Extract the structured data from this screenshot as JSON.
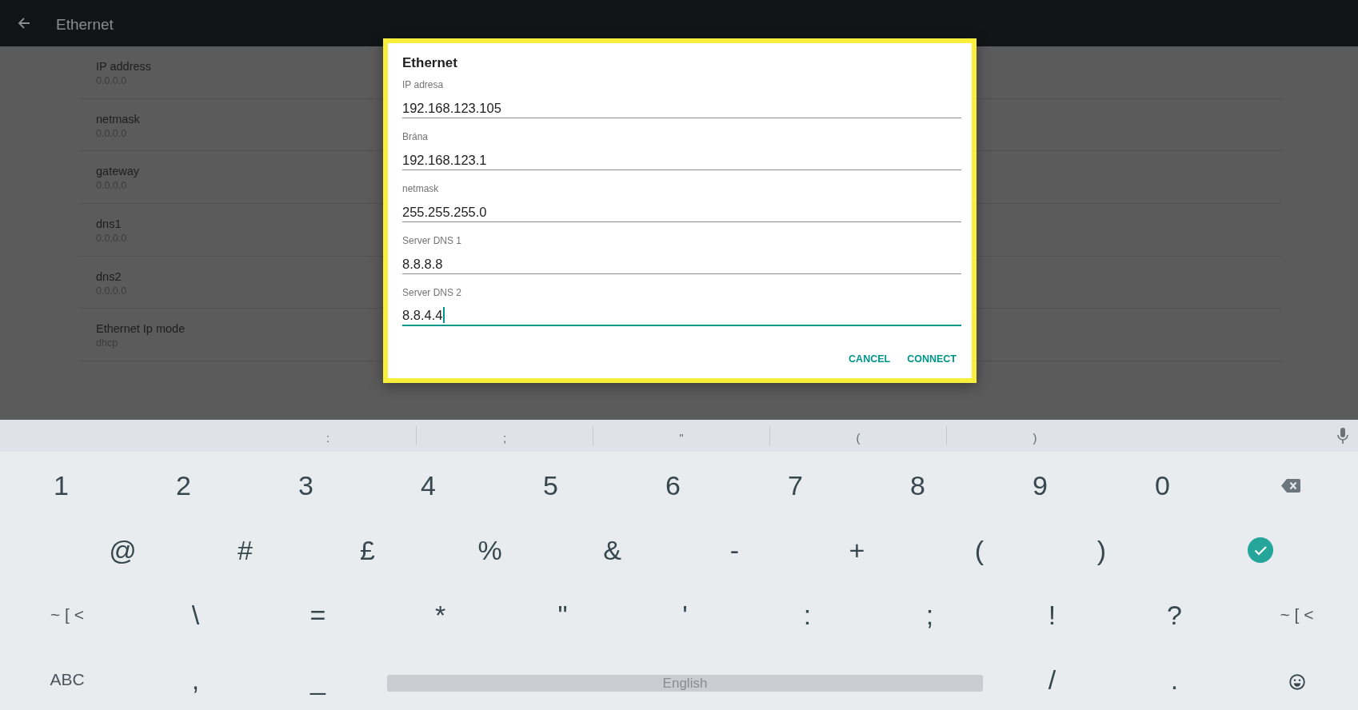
{
  "app_bar": {
    "title": "Ethernet"
  },
  "settings": [
    {
      "title": "IP address",
      "value": "0.0.0.0"
    },
    {
      "title": "netmask",
      "value": "0.0.0.0"
    },
    {
      "title": "gateway",
      "value": "0.0.0.0"
    },
    {
      "title": "dns1",
      "value": "0.0.0.0"
    },
    {
      "title": "dns2",
      "value": "0.0.0.0"
    },
    {
      "title": "Ethernet Ip mode",
      "value": "dhcp"
    }
  ],
  "dialog": {
    "title": "Ethernet",
    "fields": [
      {
        "label": "IP adresa",
        "value": "192.168.123.105",
        "focused": false
      },
      {
        "label": "Brána",
        "value": "192.168.123.1",
        "focused": false
      },
      {
        "label": "netmask",
        "value": "255.255.255.0",
        "focused": false
      },
      {
        "label": "Server DNS 1",
        "value": "8.8.8.8",
        "focused": false
      },
      {
        "label": "Server DNS 2",
        "value": "8.8.4.4",
        "focused": true
      }
    ],
    "buttons": [
      "CANCEL",
      "CONNECT"
    ]
  },
  "keyboard": {
    "suggestions": [
      ":",
      ";",
      "\"",
      "(",
      ")"
    ],
    "rows": [
      [
        {
          "kind": "char",
          "label": "1"
        },
        {
          "kind": "char",
          "label": "2"
        },
        {
          "kind": "char",
          "label": "3"
        },
        {
          "kind": "char",
          "label": "4"
        },
        {
          "kind": "char",
          "label": "5"
        },
        {
          "kind": "char",
          "label": "6"
        },
        {
          "kind": "char",
          "label": "7"
        },
        {
          "kind": "char",
          "label": "8"
        },
        {
          "kind": "char",
          "label": "9"
        },
        {
          "kind": "char",
          "label": "0"
        },
        {
          "kind": "backspace"
        }
      ],
      [
        {
          "kind": "char",
          "label": "@"
        },
        {
          "kind": "char",
          "label": "#"
        },
        {
          "kind": "char",
          "label": "£"
        },
        {
          "kind": "char",
          "label": "%"
        },
        {
          "kind": "char",
          "label": "&"
        },
        {
          "kind": "char",
          "label": "-"
        },
        {
          "kind": "char",
          "label": "+"
        },
        {
          "kind": "char",
          "label": "("
        },
        {
          "kind": "char",
          "label": ")"
        },
        {
          "kind": "enter"
        }
      ],
      [
        {
          "kind": "mode",
          "label": "~ [ <"
        },
        {
          "kind": "char",
          "label": "\\"
        },
        {
          "kind": "char",
          "label": "="
        },
        {
          "kind": "char",
          "label": "*"
        },
        {
          "kind": "char",
          "label": "\""
        },
        {
          "kind": "char",
          "label": "'"
        },
        {
          "kind": "char",
          "label": ":"
        },
        {
          "kind": "char",
          "label": ";"
        },
        {
          "kind": "char",
          "label": "!"
        },
        {
          "kind": "char",
          "label": "?"
        },
        {
          "kind": "mode",
          "label": "~ [ <"
        }
      ]
    ],
    "bottom_row": {
      "left": [
        {
          "kind": "mode",
          "label": "ABC"
        },
        {
          "kind": "char",
          "label": ","
        },
        {
          "kind": "char",
          "label": "_"
        }
      ],
      "space_bar": "English",
      "right": [
        {
          "kind": "char",
          "label": "/"
        },
        {
          "kind": "char",
          "label": "."
        },
        {
          "kind": "emoji"
        }
      ]
    }
  }
}
